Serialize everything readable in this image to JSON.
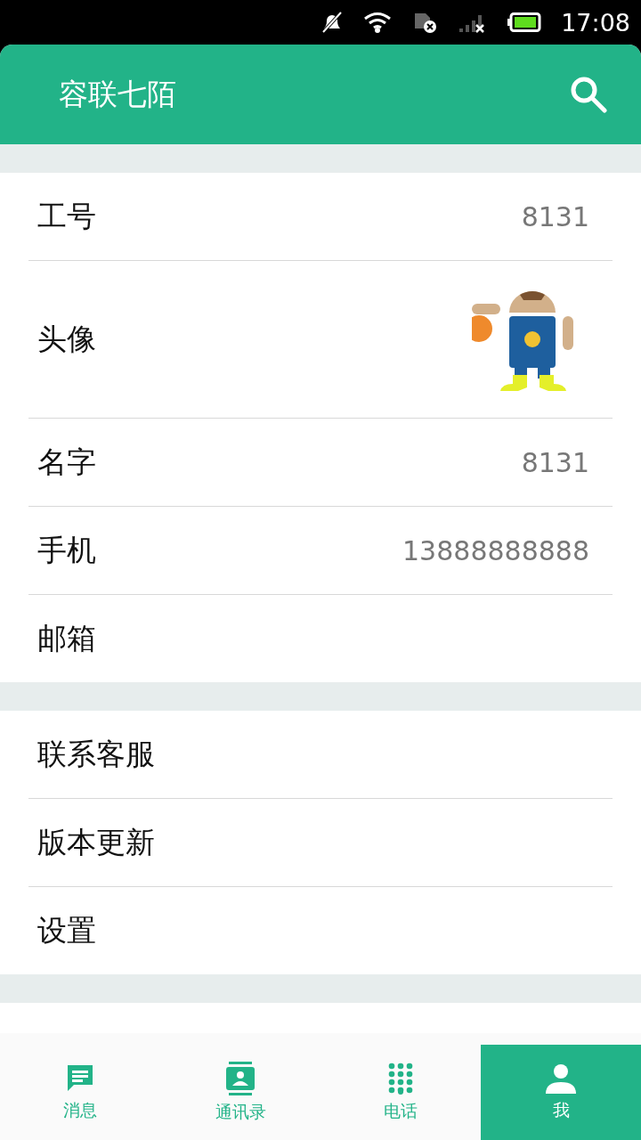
{
  "status_bar": {
    "time": "17:08"
  },
  "app_bar": {
    "title": "容联七陌"
  },
  "sections": [
    [
      {
        "kind": "text",
        "label": "工号",
        "value": "8131"
      },
      {
        "kind": "avatar",
        "label": "头像"
      },
      {
        "kind": "text",
        "label": "名字",
        "value": "8131"
      },
      {
        "kind": "text",
        "label": "手机",
        "value": "13888888888"
      },
      {
        "kind": "text",
        "label": "邮箱"
      }
    ],
    [
      {
        "kind": "text",
        "label": "联系客服"
      },
      {
        "kind": "text",
        "label": "版本更新"
      },
      {
        "kind": "text",
        "label": "设置"
      }
    ]
  ],
  "tabs": [
    {
      "label": "消息",
      "selected": false
    },
    {
      "label": "通讯录",
      "selected": false
    },
    {
      "label": "电话",
      "selected": false
    },
    {
      "label": "我",
      "selected": true
    }
  ]
}
